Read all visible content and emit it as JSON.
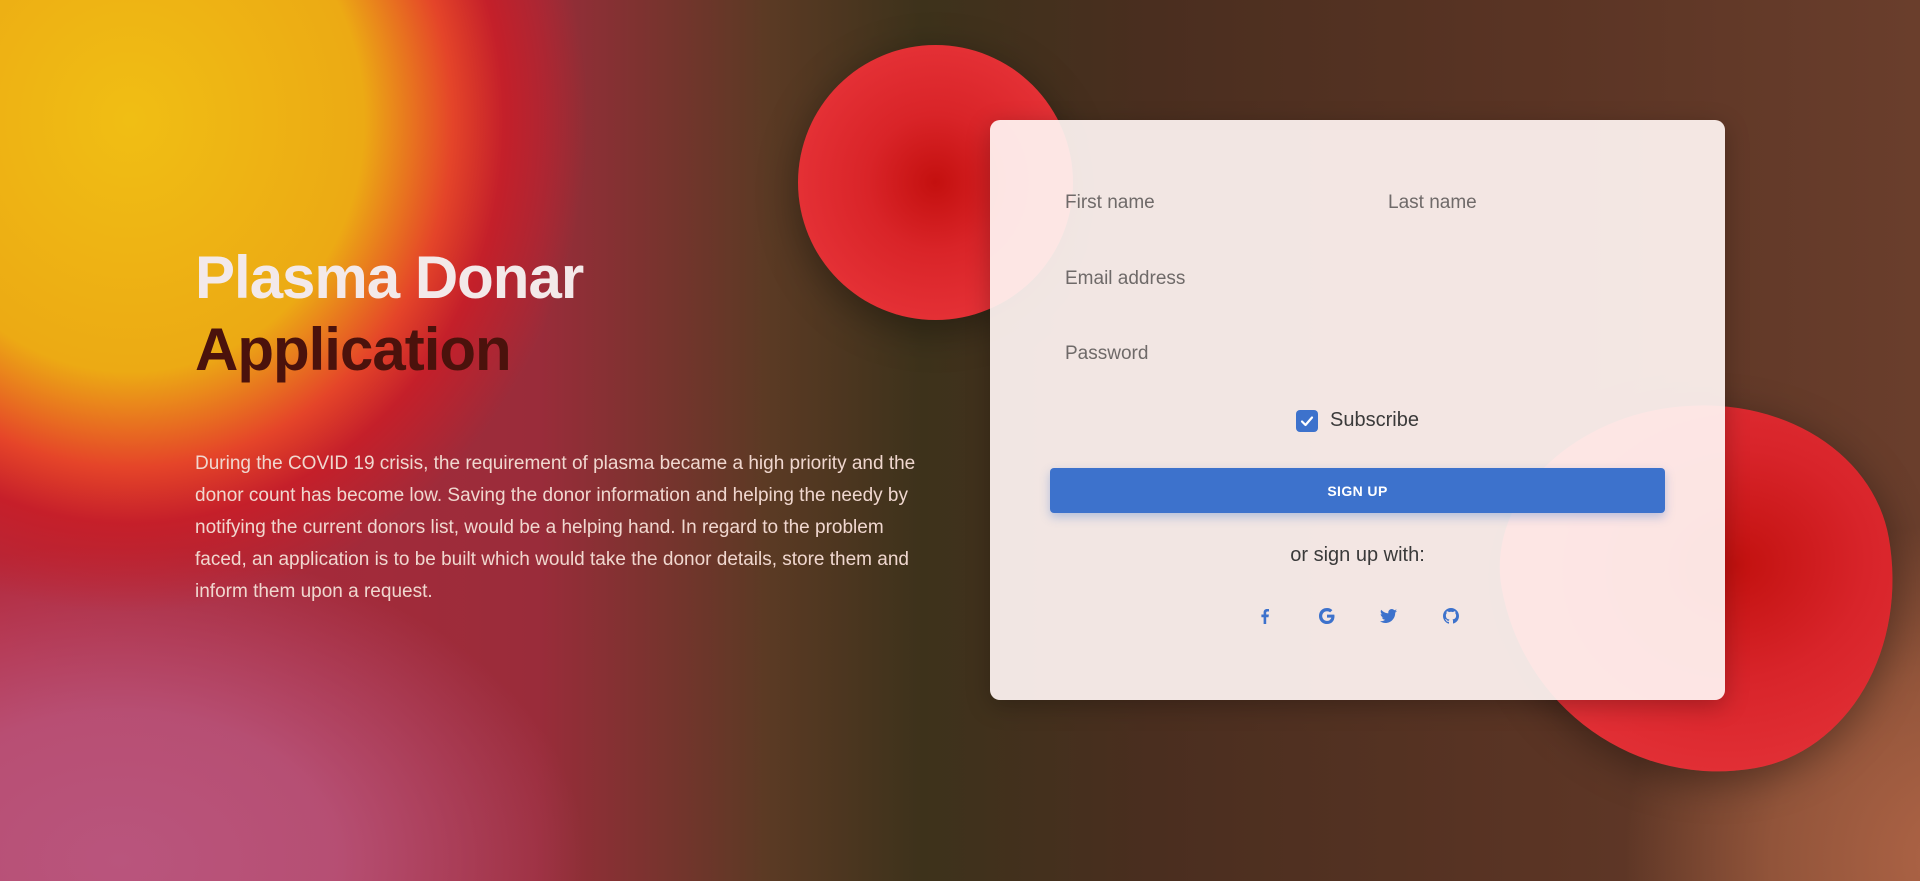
{
  "hero": {
    "title_line1": "Plasma Donar",
    "title_line2": "Application",
    "description": "During the COVID 19 crisis, the requirement of plasma became a high priority and the donor count has become low. Saving the donor information and helping the needy by notifying the current donors list, would be a helping hand. In regard to the problem faced, an application is to be built which would take the donor details, store them and inform them upon a request."
  },
  "form": {
    "first_name_placeholder": "First name",
    "last_name_placeholder": "Last name",
    "email_placeholder": "Email address",
    "password_placeholder": "Password",
    "subscribe_label": "Subscribe",
    "subscribe_checked": true,
    "signup_label": "SIGN UP",
    "alt_signup_text": "or sign up with:",
    "social_icons": [
      "facebook-icon",
      "google-icon",
      "twitter-icon",
      "github-icon"
    ]
  },
  "colors": {
    "accent": "#3d72cc",
    "title_light": "#f3e9e9",
    "title_dark": "#4b120c",
    "blob_red": "#e43035"
  }
}
